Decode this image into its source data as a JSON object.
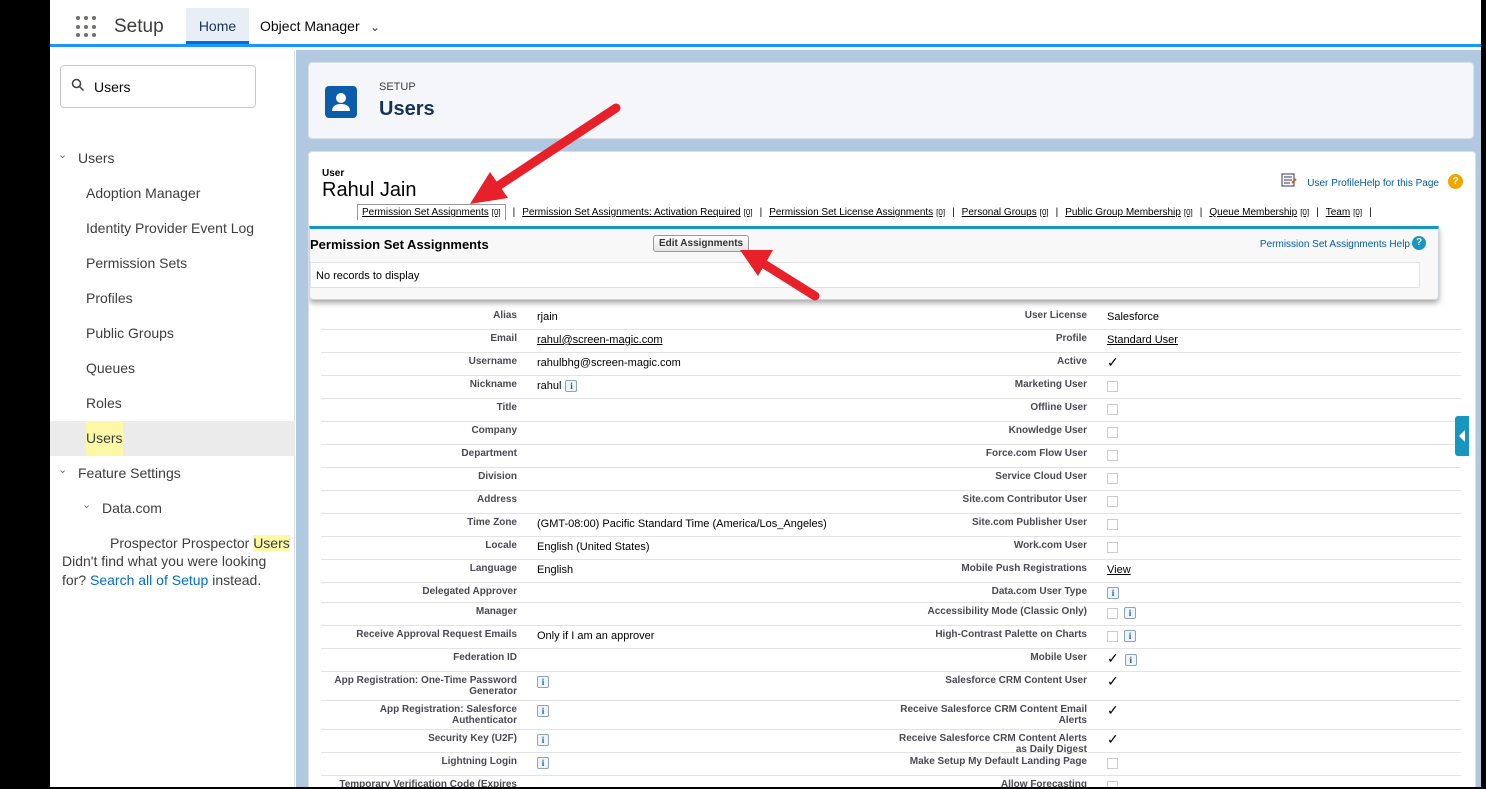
{
  "topbar": {
    "app_name": "Setup",
    "tab_home": "Home",
    "tab_object_manager": "Object Manager"
  },
  "sidebar": {
    "search_value": "Users",
    "items": [
      {
        "label": "Users",
        "level": 0,
        "expanded": true
      },
      {
        "label": "Adoption Manager",
        "level": 1
      },
      {
        "label": "Identity Provider Event Log",
        "level": 1
      },
      {
        "label": "Permission Sets",
        "level": 1
      },
      {
        "label": "Profiles",
        "level": 1
      },
      {
        "label": "Public Groups",
        "level": 1
      },
      {
        "label": "Queues",
        "level": 1
      },
      {
        "label": "Roles",
        "level": 1
      },
      {
        "label": "Users",
        "level": 1,
        "selected": true
      },
      {
        "label": "Feature Settings",
        "level": 0,
        "expanded": true
      },
      {
        "label": "Data.com",
        "level": 1,
        "expanded": true
      },
      {
        "label": "Prospector",
        "label_hl": "Users",
        "level": 2
      }
    ],
    "not_found_text": "Didn't find what you were looking for?",
    "not_found_link": "Search all of Setup",
    "not_found_suffix": "instead."
  },
  "header": {
    "eyebrow": "SETUP",
    "title": "Users"
  },
  "detail": {
    "user_label": "User",
    "user_name": "Rahul Jain",
    "help_link": "User ProfileHelp for this Page",
    "related_links": [
      {
        "label": "Permission Set Assignments",
        "count": "[0]"
      },
      {
        "label": "Permission Set Assignments: Activation Required",
        "count": "[0]"
      },
      {
        "label": "Permission Set License Assignments",
        "count": "[0]"
      },
      {
        "label": "Personal Groups",
        "count": "[0]"
      },
      {
        "label": "Public Group Membership",
        "count": "[0]"
      },
      {
        "label": "Queue Membership",
        "count": "[0]"
      },
      {
        "label": "Team",
        "count": "[0]"
      }
    ],
    "popup": {
      "title": "Permission Set Assignments",
      "edit_button": "Edit Assignments",
      "help": "Permission Set Assignments Help",
      "empty": "No records to display"
    },
    "rows": [
      {
        "l1": "Alias",
        "v1": "rjain",
        "l2": "User License",
        "v2": "Salesforce"
      },
      {
        "l1": "Email",
        "v1": "rahul@screen-magic.com",
        "v1link": true,
        "l2": "Profile",
        "v2": "Standard User",
        "v2link": true
      },
      {
        "l1": "Username",
        "v1": "rahulbhg@screen-magic.com",
        "l2": "Active",
        "v2check": "checked"
      },
      {
        "l1": "Nickname",
        "v1": "rahul",
        "v1info": true,
        "l2": "Marketing User",
        "v2check": "empty"
      },
      {
        "l1": "Title",
        "v1": "",
        "l2": "Offline User",
        "v2check": "empty"
      },
      {
        "l1": "Company",
        "v1": "",
        "l2": "Knowledge User",
        "v2check": "empty"
      },
      {
        "l1": "Department",
        "v1": "",
        "l2": "Force.com Flow User",
        "v2check": "empty"
      },
      {
        "l1": "Division",
        "v1": "",
        "l2": "Service Cloud User",
        "v2check": "empty"
      },
      {
        "l1": "Address",
        "v1": "",
        "l2": "Site.com Contributor User",
        "v2check": "empty"
      },
      {
        "l1": "Time Zone",
        "v1": "(GMT-08:00) Pacific Standard Time (America/Los_Angeles)",
        "l2": "Site.com Publisher User",
        "v2check": "empty"
      },
      {
        "l1": "Locale",
        "v1": "English (United States)",
        "l2": "Work.com User",
        "v2check": "empty"
      },
      {
        "l1": "Language",
        "v1": "English",
        "l2": "Mobile Push Registrations",
        "v2": "View",
        "v2link": true
      },
      {
        "l1": "Delegated Approver",
        "v1": "",
        "l2": "Data.com User Type",
        "v2info": true
      },
      {
        "l1": "Manager",
        "v1": "",
        "l2": "Accessibility Mode (Classic Only)",
        "v2check": "empty",
        "v2info": true
      },
      {
        "l1": "Receive Approval Request Emails",
        "v1": "Only if I am an approver",
        "l2": "High-Contrast Palette on Charts",
        "v2check": "empty",
        "v2info": true
      },
      {
        "l1": "Federation ID",
        "v1": "",
        "l2": "Mobile User",
        "v2check": "checked",
        "v2info": true
      },
      {
        "l1": "App Registration: One-Time Password Generator",
        "v1info": true,
        "l2": "Salesforce CRM Content User",
        "v2check": "checked"
      },
      {
        "l1": "App Registration: Salesforce Authenticator",
        "v1info": true,
        "l2": "Receive Salesforce CRM Content Email Alerts",
        "v2check": "checked"
      },
      {
        "l1": "Security Key (U2F)",
        "v1info": true,
        "l2": "Receive Salesforce CRM Content Alerts as Daily Digest",
        "v2check": "checked"
      },
      {
        "l1": "Lightning Login",
        "v1info": true,
        "l2": "Make Setup My Default Landing Page",
        "v2check": "empty"
      },
      {
        "l1": "Temporary Verification Code (Expires",
        "v1": "",
        "l2": "Allow Forecasting",
        "v2check": "empty"
      }
    ]
  }
}
